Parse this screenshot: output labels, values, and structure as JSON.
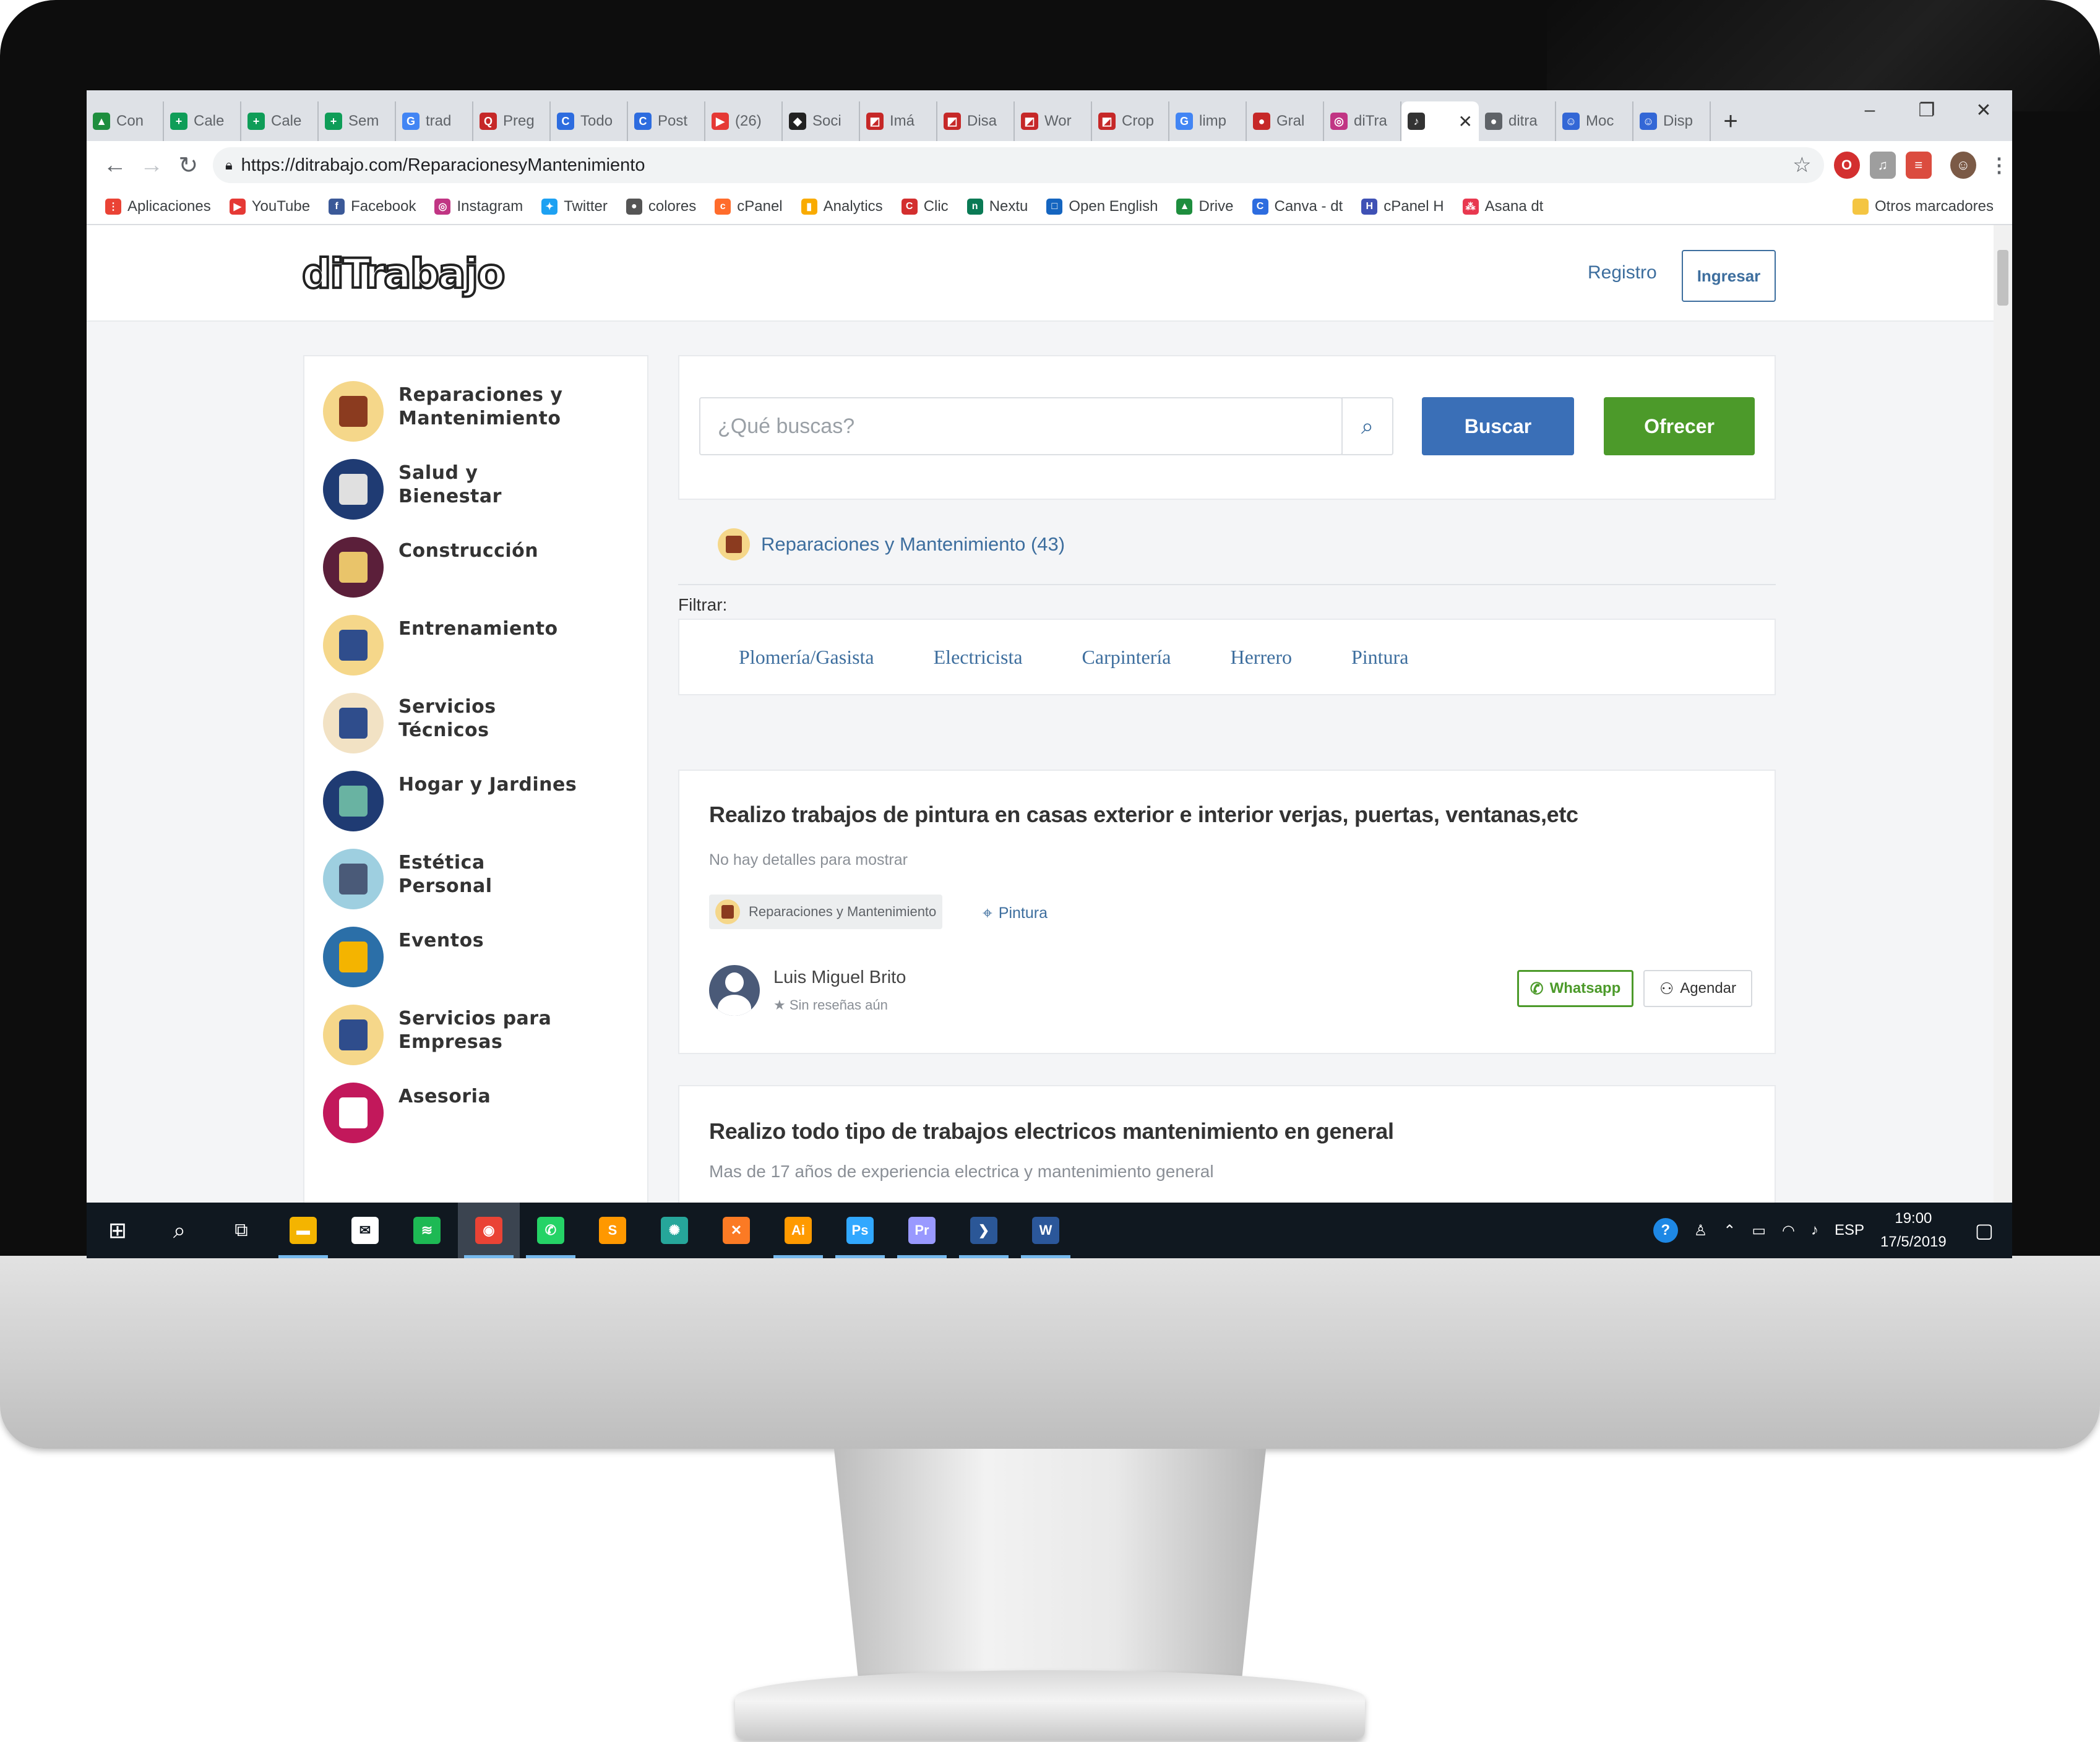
{
  "browser": {
    "tabs": [
      {
        "label": "Con",
        "color": "#1e8e3e",
        "glyph": "▲"
      },
      {
        "label": "Cale",
        "color": "#0f9d58",
        "glyph": "+"
      },
      {
        "label": "Cale",
        "color": "#0f9d58",
        "glyph": "+"
      },
      {
        "label": "Sem",
        "color": "#0f9d58",
        "glyph": "+"
      },
      {
        "label": "trad",
        "color": "#4285f4",
        "glyph": "G"
      },
      {
        "label": "Preg",
        "color": "#c62828",
        "glyph": "Q"
      },
      {
        "label": "Todo",
        "color": "#2d6cdf",
        "glyph": "C"
      },
      {
        "label": "Post",
        "color": "#2d6cdf",
        "glyph": "C"
      },
      {
        "label": "(26)",
        "color": "#e53935",
        "glyph": "▶"
      },
      {
        "label": "Soci",
        "color": "#222222",
        "glyph": "◆"
      },
      {
        "label": "Imá",
        "color": "#c62828",
        "glyph": "◩"
      },
      {
        "label": "Disa",
        "color": "#c62828",
        "glyph": "◩"
      },
      {
        "label": "Wor",
        "color": "#c62828",
        "glyph": "◩"
      },
      {
        "label": "Crop",
        "color": "#c62828",
        "glyph": "◩"
      },
      {
        "label": "limp",
        "color": "#4285f4",
        "glyph": "G"
      },
      {
        "label": "Gral",
        "color": "#c62828",
        "glyph": "●"
      },
      {
        "label": "diTra",
        "color": "#c13584",
        "glyph": "◎"
      },
      {
        "label": "",
        "color": "#333333",
        "glyph": "♪",
        "active": true
      },
      {
        "label": "ditra",
        "color": "#5f6368",
        "glyph": "●"
      },
      {
        "label": "Moc",
        "color": "#3367d6",
        "glyph": "☺"
      },
      {
        "label": "Disp",
        "color": "#3367d6",
        "glyph": "☺"
      }
    ],
    "url": "https://ditrabajo.com/ReparacionesyMantenimiento",
    "bookmarks": [
      {
        "label": "Aplicaciones",
        "color": "#ea4335",
        "glyph": "⋮"
      },
      {
        "label": "YouTube",
        "color": "#e53935",
        "glyph": "▶"
      },
      {
        "label": "Facebook",
        "color": "#3b5998",
        "glyph": "f"
      },
      {
        "label": "Instagram",
        "color": "#c13584",
        "glyph": "◎"
      },
      {
        "label": "Twitter",
        "color": "#1da1f2",
        "glyph": "✦"
      },
      {
        "label": "colores",
        "color": "#555555",
        "glyph": "●"
      },
      {
        "label": "cPanel",
        "color": "#ff6c2c",
        "glyph": "c"
      },
      {
        "label": "Analytics",
        "color": "#f9ab00",
        "glyph": "▮"
      },
      {
        "label": "Clic",
        "color": "#d32f2f",
        "glyph": "C"
      },
      {
        "label": "Nextu",
        "color": "#0a7a55",
        "glyph": "n"
      },
      {
        "label": "Open English",
        "color": "#1565c0",
        "glyph": "□"
      },
      {
        "label": "Drive",
        "color": "#1e8e3e",
        "glyph": "▲"
      },
      {
        "label": "Canva - dt",
        "color": "#2d6cdf",
        "glyph": "C"
      },
      {
        "label": "cPanel H",
        "color": "#3f51b5",
        "glyph": "H"
      },
      {
        "label": "Asana dt",
        "color": "#e8384f",
        "glyph": "⁂"
      }
    ],
    "other_bookmarks": "Otros marcadores"
  },
  "site": {
    "logo": "diTrabajo",
    "registro": "Registro",
    "ingresar": "Ingresar"
  },
  "categories": [
    {
      "label": "Reparaciones y Mantenimiento",
      "bg": "#f5d78a",
      "fg": "#8b3b1f",
      "icon": "house-icon"
    },
    {
      "label": "Salud y Bienestar",
      "bg": "#1f3b73",
      "fg": "#e0e0e0",
      "icon": "heart-hand-icon"
    },
    {
      "label": "Construcción",
      "bg": "#5b1f3a",
      "fg": "#e9c46a",
      "icon": "construction-icon"
    },
    {
      "label": "Entrenamiento",
      "bg": "#f5d78a",
      "fg": "#2f4d8c",
      "icon": "whistle-icon"
    },
    {
      "label": "Servicios Técnicos",
      "bg": "#f2e2c4",
      "fg": "#2f4d8c",
      "icon": "wrench-icon"
    },
    {
      "label": "Hogar y Jardines",
      "bg": "#1f3b73",
      "fg": "#69b3a2",
      "icon": "garden-icon"
    },
    {
      "label": "Estética Personal",
      "bg": "#9ecfe0",
      "fg": "#4a5a78",
      "icon": "scissors-icon"
    },
    {
      "label": "Eventos",
      "bg": "#2b6fa8",
      "fg": "#f4b400",
      "icon": "headphones-icon"
    },
    {
      "label": "Servicios para Empresas",
      "bg": "#f5d78a",
      "fg": "#2f4d8c",
      "icon": "office-chair-icon"
    },
    {
      "label": "Asesoria",
      "bg": "#c2185b",
      "fg": "#ffffff",
      "icon": "suit-icon"
    }
  ],
  "search": {
    "placeholder": "¿Qué buscas?",
    "buscar": "Buscar",
    "ofrecer": "Ofrecer"
  },
  "breadcrumb": "Reparaciones y Mantenimiento (43)",
  "filter": {
    "label": "Filtrar:",
    "options": [
      "Plomería/Gasista",
      "Electricista",
      "Carpintería",
      "Herrero",
      "Pintura"
    ]
  },
  "listings": [
    {
      "title": "Realizo trabajos de pintura en casas exterior e interior verjas, puertas, ventanas,etc",
      "description": "No hay detalles para mostrar",
      "category": "Reparaciones y Mantenimiento",
      "location": "Pintura",
      "author": "Luis Miguel Brito",
      "reviews": "Sin reseñas aún",
      "whatsapp": "Whatsapp",
      "agendar": "Agendar"
    },
    {
      "title": "Realizo todo tipo de trabajos electricos mantenimiento en general",
      "description": "Mas de 17 años de experiencia electrica y mantenimiento general"
    }
  ],
  "taskbar": {
    "apps": [
      {
        "name": "file-explorer-icon",
        "color": "#f4b400",
        "glyph": "▬",
        "running": true
      },
      {
        "name": "mail-icon",
        "color": "#ffffff",
        "glyph": "✉",
        "running": false
      },
      {
        "name": "spotify-icon",
        "color": "#1db954",
        "glyph": "≋",
        "running": false
      },
      {
        "name": "chrome-icon",
        "color": "#ea4335",
        "glyph": "◉",
        "running": true,
        "active": true
      },
      {
        "name": "whatsapp-icon",
        "color": "#25d366",
        "glyph": "✆",
        "running": true
      },
      {
        "name": "sublime-icon",
        "color": "#ff9800",
        "glyph": "S",
        "running": false
      },
      {
        "name": "network-app-icon",
        "color": "#26a69a",
        "glyph": "✺",
        "running": false
      },
      {
        "name": "xampp-icon",
        "color": "#fb7a24",
        "glyph": "✕",
        "running": false
      },
      {
        "name": "illustrator-icon",
        "color": "#ff9a00",
        "glyph": "Ai",
        "running": true
      },
      {
        "name": "photoshop-icon",
        "color": "#31a8ff",
        "glyph": "Ps",
        "running": true
      },
      {
        "name": "premiere-icon",
        "color": "#9999ff",
        "glyph": "Pr",
        "running": true
      },
      {
        "name": "powershell-icon",
        "color": "#2b5797",
        "glyph": "❯",
        "running": true
      },
      {
        "name": "word-icon",
        "color": "#2b579a",
        "glyph": "W",
        "running": true
      }
    ],
    "language": "ESP",
    "time": "19:00",
    "date": "17/5/2019"
  }
}
